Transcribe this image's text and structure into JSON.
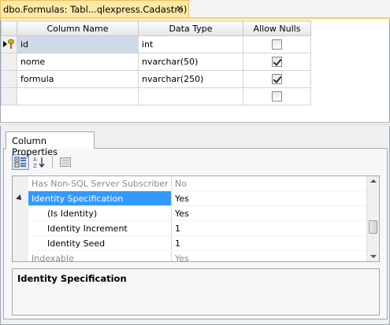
{
  "document_tab": {
    "title": "dbo.Formulas: Tabl...qlexpress.Cadastro)",
    "close_glyph": "✕"
  },
  "columns_grid": {
    "headers": [
      "Column Name",
      "Data Type",
      "Allow Nulls"
    ],
    "rows": [
      {
        "name": "id",
        "type": "int",
        "allow_nulls": false,
        "primary_key": true,
        "current": true
      },
      {
        "name": "nome",
        "type": "nvarchar(50)",
        "allow_nulls": true
      },
      {
        "name": "formula",
        "type": "nvarchar(250)",
        "allow_nulls": true
      },
      {
        "name": "",
        "type": "",
        "allow_nulls": false
      }
    ]
  },
  "properties_panel": {
    "tab_label": "Column Properties",
    "toolbar_icons": [
      "categorized-icon",
      "alphabetical-sort-icon",
      "property-pages-icon"
    ],
    "rows": [
      {
        "name": "Has Non-SQL Server Subscriber",
        "value": "No",
        "greyed": true
      },
      {
        "name": "Identity Specification",
        "value": "Yes",
        "expanded": true,
        "selected": true
      },
      {
        "name": "(Is Identity)",
        "value": "Yes",
        "sub": true
      },
      {
        "name": "Identity Increment",
        "value": "1",
        "sub": true
      },
      {
        "name": "Identity Seed",
        "value": "1",
        "sub": true
      },
      {
        "name": "Indexable",
        "value": "Yes",
        "greyed": true
      }
    ],
    "scroll_position": 0.62,
    "description_title": "Identity Specification"
  },
  "colors": {
    "active_tab": "#ffe8a6",
    "selection": "#3399ff",
    "grid_selection": "#cfd9e8"
  }
}
